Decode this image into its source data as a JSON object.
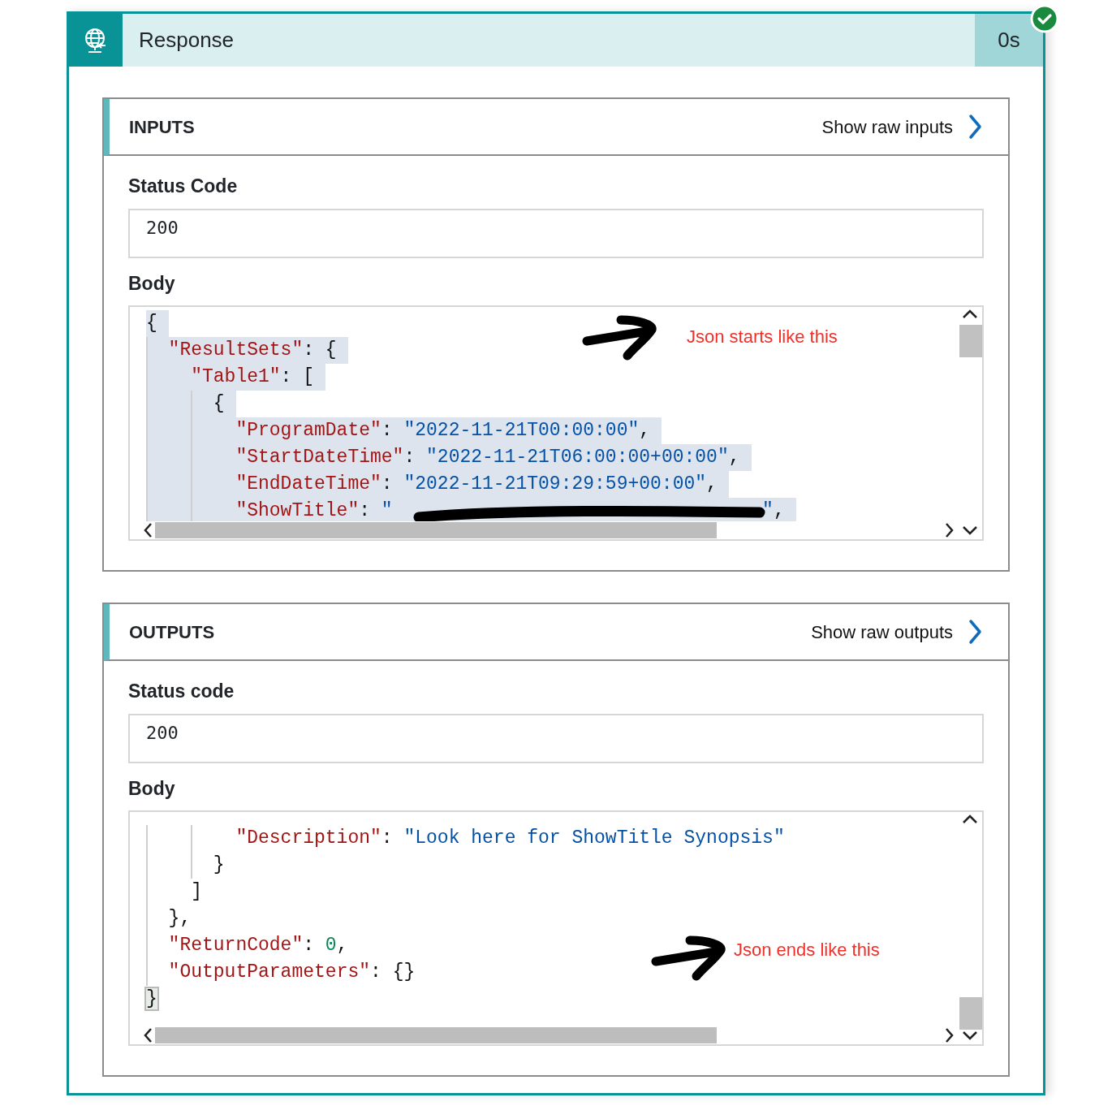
{
  "action": {
    "title": "Response",
    "duration": "0s",
    "succeeded": true
  },
  "sections": [
    {
      "heading": "INPUTS",
      "raw_link": "Show raw inputs",
      "status_label": "Status Code",
      "status_value": "200",
      "body_label": "Body",
      "annotation": "Json starts like this",
      "lines": [
        {
          "selected": true,
          "tokens": [
            {
              "kind": "punct",
              "text": "{"
            }
          ]
        },
        {
          "selected": true,
          "tokens": [
            {
              "kind": "key",
              "text": "  \"ResultSets\""
            },
            {
              "kind": "punct",
              "text": ": {"
            }
          ]
        },
        {
          "selected": true,
          "tokens": [
            {
              "kind": "key",
              "text": "    \"Table1\""
            },
            {
              "kind": "punct",
              "text": ": ["
            }
          ]
        },
        {
          "selected": true,
          "tokens": [
            {
              "kind": "punct",
              "text": "      {"
            }
          ]
        },
        {
          "selected": true,
          "tokens": [
            {
              "kind": "key",
              "text": "        \"ProgramDate\""
            },
            {
              "kind": "punct",
              "text": ": "
            },
            {
              "kind": "string",
              "text": "\"2022-11-21T00:00:00\""
            },
            {
              "kind": "punct",
              "text": ","
            }
          ]
        },
        {
          "selected": true,
          "tokens": [
            {
              "kind": "key",
              "text": "        \"StartDateTime\""
            },
            {
              "kind": "punct",
              "text": ": "
            },
            {
              "kind": "string",
              "text": "\"2022-11-21T06:00:00+00:00\""
            },
            {
              "kind": "punct",
              "text": ","
            }
          ]
        },
        {
          "selected": true,
          "tokens": [
            {
              "kind": "key",
              "text": "        \"EndDateTime\""
            },
            {
              "kind": "punct",
              "text": ": "
            },
            {
              "kind": "string",
              "text": "\"2022-11-21T09:29:59+00:00\""
            },
            {
              "kind": "punct",
              "text": ","
            }
          ]
        },
        {
          "selected": true,
          "tokens": [
            {
              "kind": "key",
              "text": "        \"ShowTitle\""
            },
            {
              "kind": "punct",
              "text": ": "
            },
            {
              "kind": "string",
              "text": "\""
            },
            {
              "kind": "redaction"
            },
            {
              "kind": "string",
              "text": "\""
            },
            {
              "kind": "punct",
              "text": ","
            }
          ]
        }
      ]
    },
    {
      "heading": "OUTPUTS",
      "raw_link": "Show raw outputs",
      "status_label": "Status code",
      "status_value": "200",
      "body_label": "Body",
      "annotation": "Json ends like this",
      "lines": [
        {
          "selected": false,
          "tokens": [
            {
              "kind": "key",
              "text": "        \"Description\""
            },
            {
              "kind": "punct",
              "text": ": "
            },
            {
              "kind": "string",
              "text": "\"Look here for ShowTitle Synopsis\""
            }
          ]
        },
        {
          "selected": false,
          "tokens": [
            {
              "kind": "punct",
              "text": "      }"
            }
          ]
        },
        {
          "selected": false,
          "tokens": [
            {
              "kind": "punct",
              "text": "    ]"
            }
          ]
        },
        {
          "selected": false,
          "tokens": [
            {
              "kind": "punct",
              "text": "  },"
            }
          ]
        },
        {
          "selected": false,
          "tokens": [
            {
              "kind": "key",
              "text": "  \"ReturnCode\""
            },
            {
              "kind": "punct",
              "text": ": "
            },
            {
              "kind": "number",
              "text": "0"
            },
            {
              "kind": "punct",
              "text": ","
            }
          ]
        },
        {
          "selected": false,
          "tokens": [
            {
              "kind": "key",
              "text": "  \"OutputParameters\""
            },
            {
              "kind": "punct",
              "text": ": {}"
            }
          ]
        },
        {
          "selected": false,
          "tokens": [
            {
              "kind": "matched_punct",
              "text": "}"
            }
          ]
        }
      ]
    }
  ]
}
